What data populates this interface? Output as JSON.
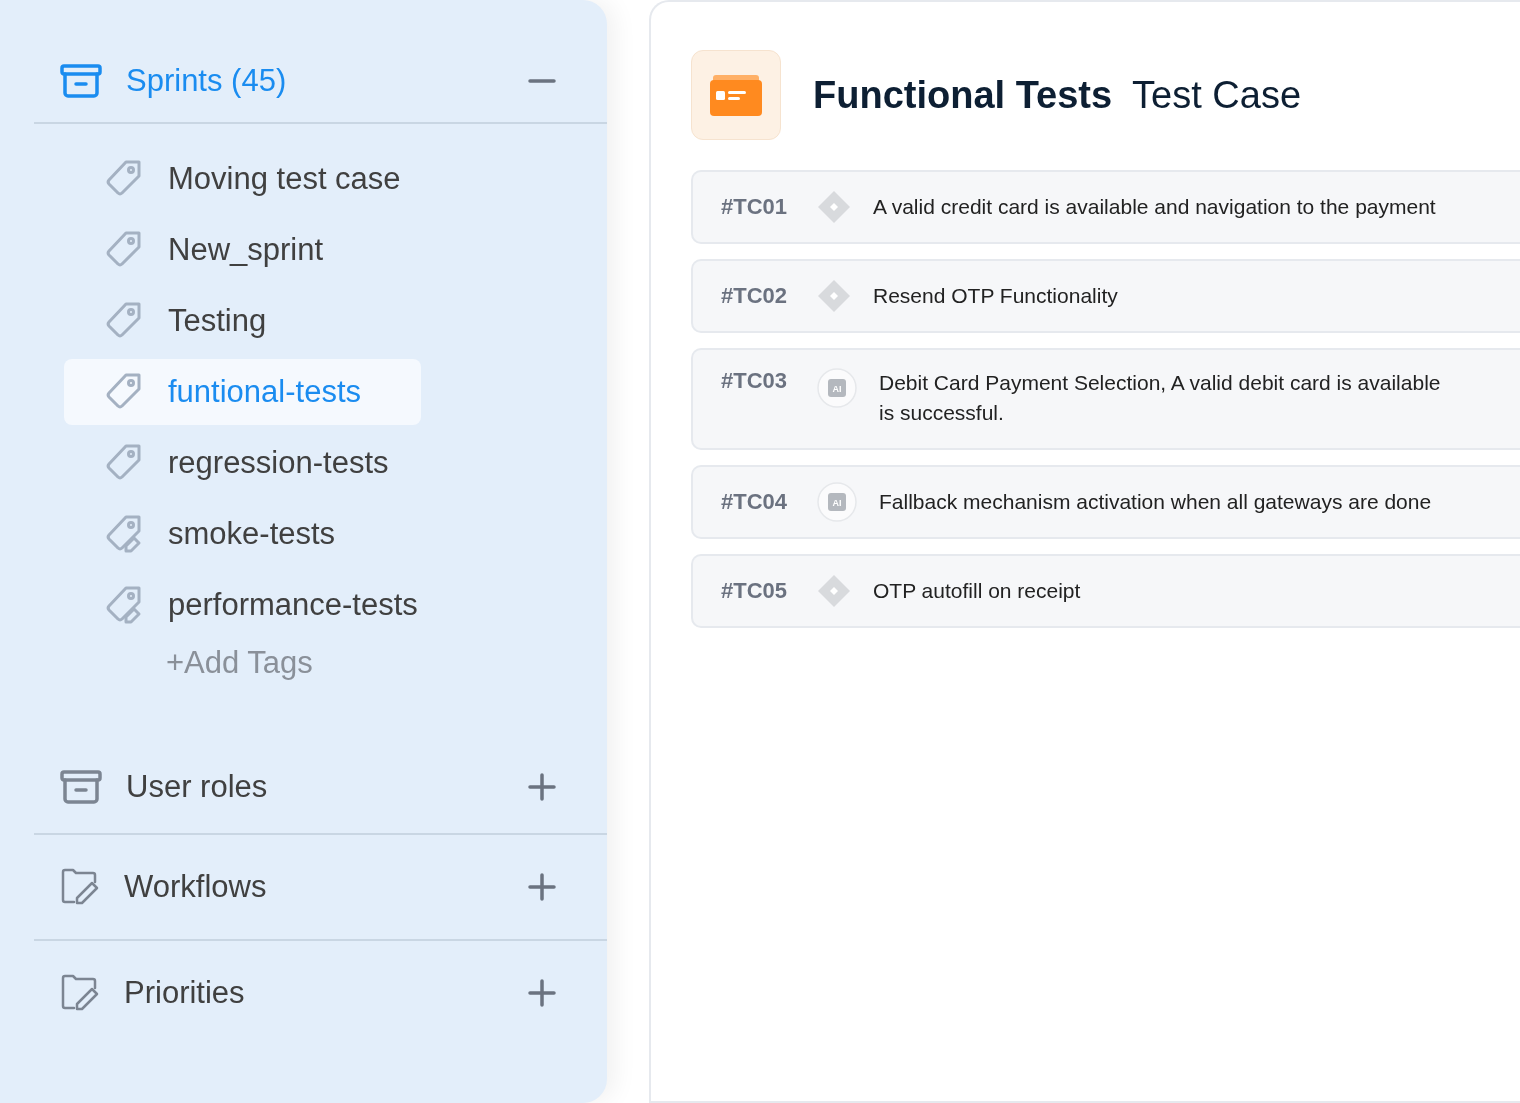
{
  "sidebar": {
    "sections": [
      {
        "title": "Sprints (45)",
        "kind": "archive",
        "expanded": true,
        "items": [
          {
            "label": "Moving test case",
            "kind": "tag",
            "selected": false
          },
          {
            "label": "New_sprint",
            "kind": "tag",
            "selected": false
          },
          {
            "label": "Testing",
            "kind": "tag",
            "selected": false
          },
          {
            "label": "funtional-tests",
            "kind": "tag",
            "selected": true
          },
          {
            "label": "regression-tests",
            "kind": "tag",
            "selected": false
          },
          {
            "label": "smoke-tests",
            "kind": "tag-edit",
            "selected": false
          },
          {
            "label": "performance-tests",
            "kind": "tag-edit",
            "selected": false
          }
        ],
        "add_link": "+Add Tags"
      },
      {
        "title": "User roles",
        "kind": "archive",
        "expanded": false
      },
      {
        "title": "Workflows",
        "kind": "folder-edit",
        "expanded": false
      },
      {
        "title": "Priorities",
        "kind": "folder-edit",
        "expanded": false
      }
    ]
  },
  "content": {
    "title": "Functional Tests",
    "subtitle": "Test Case",
    "test_cases": [
      {
        "id": "#TC01",
        "kind": "diamond",
        "text": "A valid credit card is available and navigation to the payment"
      },
      {
        "id": "#TC02",
        "kind": "diamond",
        "text": "Resend OTP Functionality"
      },
      {
        "id": "#TC03",
        "kind": "ai",
        "badge": "AI",
        "text": "Debit Card Payment Selection, A valid debit card is available",
        "text_2": "is successful."
      },
      {
        "id": "#TC04",
        "kind": "ai",
        "badge": "AI",
        "text": "Fallback mechanism activation when all gateways are done"
      },
      {
        "id": "#TC05",
        "kind": "diamond",
        "text": "OTP autofill on receipt"
      }
    ]
  }
}
